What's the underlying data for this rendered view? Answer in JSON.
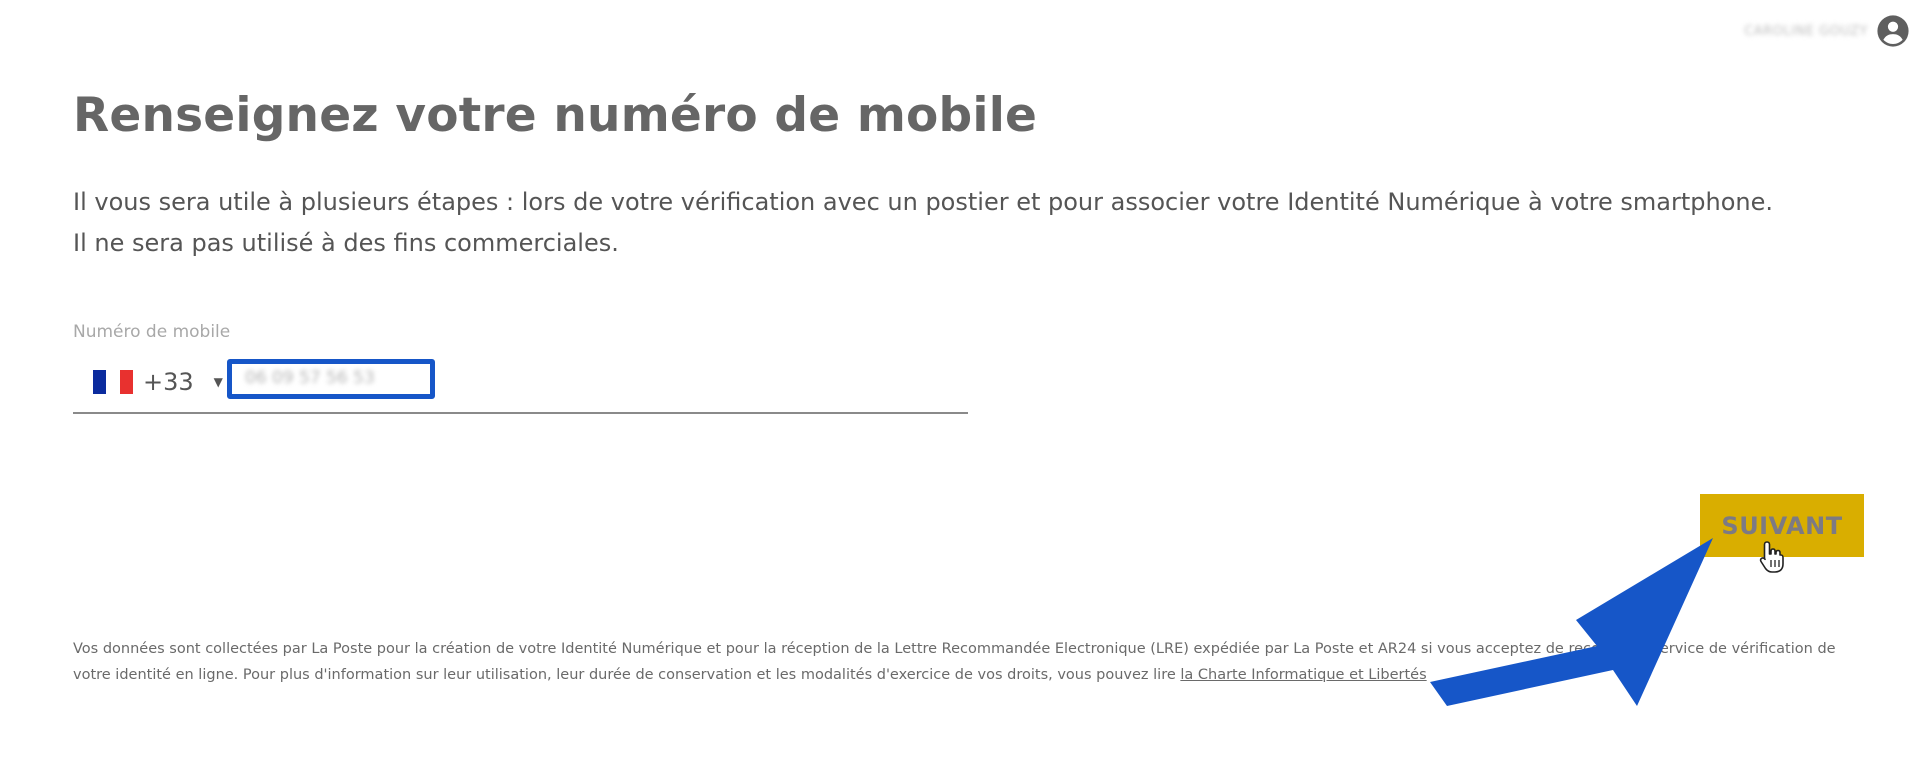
{
  "header": {
    "user_name": "CAROLINE GOUZY"
  },
  "main": {
    "title": "Renseignez votre numéro de mobile",
    "description": "Il vous sera utile à plusieurs étapes : lors de votre vérification avec un postier et pour associer votre Identité Numérique à votre smartphone. Il ne sera pas utilisé à des fins commerciales.",
    "phone_field": {
      "label": "Numéro de mobile",
      "country_dial_code": "+33",
      "country_flag": "france-flag",
      "value": "06 09 57 56 53"
    },
    "next_button_label": "SUIVANT"
  },
  "footer": {
    "legal_text": "Vos données sont collectées par La Poste pour la création de votre Identité Numérique et pour la réception de la Lettre Recommandée Electronique (LRE) expédiée par La Poste et AR24 si vous acceptez de recourir au service de vérification de votre identité en ligne. Pour plus d'information sur leur utilisation, leur durée de conservation et les modalités d'exercice de vos droits, vous pouvez lire",
    "legal_link": "la Charte Informatique et Libertés"
  },
  "colors": {
    "accent_button": "#d9ae00",
    "highlight_border": "#1656c8",
    "annotation_arrow": "#1656c8",
    "title_text": "#666666"
  },
  "icons": [
    "user-account-icon",
    "france-flag-icon",
    "caret-down-icon",
    "hand-cursor-icon",
    "annotation-arrow-icon"
  ]
}
